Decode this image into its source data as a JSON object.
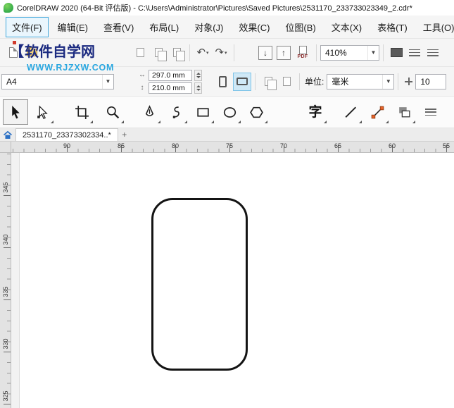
{
  "titlebar": {
    "title": "CorelDRAW 2020 (64-Bit 评估版) - C:\\Users\\Administrator\\Pictures\\Saved Pictures\\2531170_233733023349_2.cdr*"
  },
  "menubar": {
    "items": [
      {
        "key": "file",
        "label": "文件(F)",
        "active": true
      },
      {
        "key": "edit",
        "label": "编辑(E)",
        "active": false
      },
      {
        "key": "view",
        "label": "查看(V)",
        "active": false
      },
      {
        "key": "layout",
        "label": "布局(L)",
        "active": false
      },
      {
        "key": "object",
        "label": "对象(J)",
        "active": false
      },
      {
        "key": "effects",
        "label": "效果(C)",
        "active": false
      },
      {
        "key": "bitmaps",
        "label": "位图(B)",
        "active": false
      },
      {
        "key": "text",
        "label": "文本(X)",
        "active": false
      },
      {
        "key": "table",
        "label": "表格(T)",
        "active": false
      },
      {
        "key": "tools",
        "label": "工具(O)",
        "active": false
      }
    ]
  },
  "watermark": {
    "line1": "软件自学网",
    "line2": "WWW.RJZXW.COM"
  },
  "standard_toolbar": {
    "zoom_value": "410%",
    "pdf_label": "PDF",
    "import_glyph": "↓",
    "export_glyph": "↑",
    "undo_glyph": "↶",
    "redo_glyph": "↷"
  },
  "property_bar": {
    "page_size": "A4",
    "width_value": "297.0 mm",
    "height_value": "210.0 mm",
    "units_label": "单位:",
    "units_value": "毫米",
    "nudge_value": "10"
  },
  "toolbox": {
    "text_tool_glyph": "字",
    "tools": [
      "pick",
      "shape",
      "crop",
      "zoom",
      "pen",
      "bspline",
      "rectangle",
      "ellipse",
      "polygon",
      "text",
      "line",
      "dimension",
      "overlap",
      "more"
    ]
  },
  "tabbar": {
    "document_tab": "2531170_23373302334..*",
    "new_tab": "+"
  },
  "rulers": {
    "horizontal_labels": [
      "90",
      "85",
      "80",
      "75",
      "70",
      "65",
      "60",
      "55"
    ],
    "vertical_labels": [
      "345",
      "340",
      "335",
      "330",
      "325"
    ]
  },
  "canvas": {
    "shape": "rounded-rectangle-outline"
  },
  "colors": {
    "accent": "#41a8dc",
    "watermark_blue": "#1b2a80",
    "watermark_cyan": "#2aa7e0",
    "handle_orange": "#e8632a",
    "shape_stroke": "#141414"
  }
}
